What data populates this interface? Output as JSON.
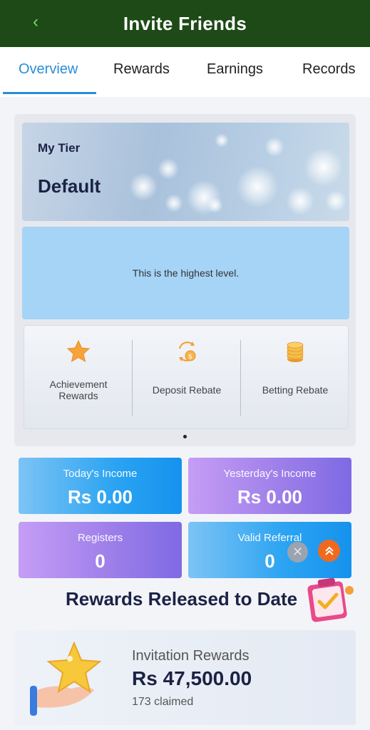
{
  "header": {
    "title": "Invite Friends",
    "back_icon": "chevron-left-icon"
  },
  "tabs": [
    {
      "label": "Overview",
      "active": true
    },
    {
      "label": "Rewards",
      "active": false
    },
    {
      "label": "Earnings",
      "active": false
    },
    {
      "label": "Records",
      "active": false
    }
  ],
  "tier": {
    "label": "My Tier",
    "name": "Default",
    "message": "This is the highest level."
  },
  "benefits": [
    {
      "label": "Achievement Rewards",
      "icon": "star-icon"
    },
    {
      "label": "Deposit Rebate",
      "icon": "rebate-cycle-icon"
    },
    {
      "label": "Betting Rebate",
      "icon": "coin-stack-icon"
    }
  ],
  "stats": {
    "today_income": {
      "title": "Today's Income",
      "value": "Rs  0.00"
    },
    "yesterday_income": {
      "title": "Yesterday's Income",
      "value": "Rs  0.00"
    },
    "registers": {
      "title": "Registers",
      "value": "0"
    },
    "valid_referral": {
      "title": "Valid Referral",
      "value": "0"
    }
  },
  "floating": {
    "close_icon": "close-icon",
    "top_icon": "double-chevron-up-icon"
  },
  "rewards_released": {
    "section_title": "Rewards Released to Date",
    "card_title": "Invitation Rewards",
    "amount": "Rs  47,500.00",
    "claimed": "173 claimed"
  },
  "colors": {
    "header_bg": "#1d4a17",
    "accent": "#2a8dd8",
    "navy_text": "#1b2244",
    "stat_blue": "#2aa3f2",
    "stat_purple": "#9b7de9"
  }
}
